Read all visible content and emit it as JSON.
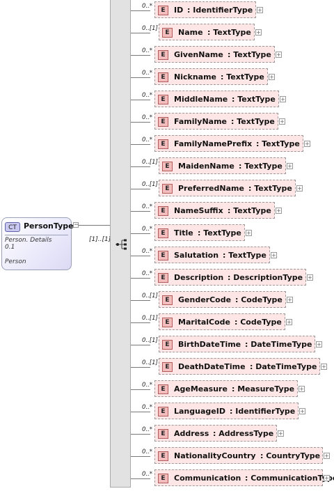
{
  "complex_type": {
    "badge": "CT",
    "name": "PersonType",
    "description": "Person. Details",
    "version": "0.1",
    "label": "Person",
    "collapse_symbol": "−"
  },
  "sequence": {
    "cardinality": "[1]..[1]"
  },
  "expand_symbol": "+",
  "element_badge": "E",
  "elements": [
    {
      "name": "ID",
      "type": ": IdentifierType",
      "card": "0..*"
    },
    {
      "name": "Name",
      "type": ": TextType",
      "card": "0..[1]"
    },
    {
      "name": "GivenName",
      "type": ": TextType",
      "card": "0..*"
    },
    {
      "name": "Nickname",
      "type": ": TextType",
      "card": "0..*"
    },
    {
      "name": "MiddleName",
      "type": ": TextType",
      "card": "0..*"
    },
    {
      "name": "FamilyName",
      "type": ": TextType",
      "card": "0..*"
    },
    {
      "name": "FamilyNamePrefix",
      "type": ": TextType",
      "card": "0..*"
    },
    {
      "name": "MaidenName",
      "type": ": TextType",
      "card": "0..[1]"
    },
    {
      "name": "PreferredName",
      "type": ": TextType",
      "card": "0..[1]"
    },
    {
      "name": "NameSuffix",
      "type": ": TextType",
      "card": "0..*"
    },
    {
      "name": "Title",
      "type": ": TextType",
      "card": "0..*"
    },
    {
      "name": "Salutation",
      "type": ": TextType",
      "card": "0..*"
    },
    {
      "name": "Description",
      "type": ": DescriptionType",
      "card": "0..*"
    },
    {
      "name": "GenderCode",
      "type": ": CodeType",
      "card": "0..[1]"
    },
    {
      "name": "MaritalCode",
      "type": ": CodeType",
      "card": "0..[1]"
    },
    {
      "name": "BirthDateTime",
      "type": ": DateTimeType",
      "card": "0..[1]"
    },
    {
      "name": "DeathDateTime",
      "type": ": DateTimeType",
      "card": "0..[1]"
    },
    {
      "name": "AgeMeasure",
      "type": ": MeasureType",
      "card": "0..*"
    },
    {
      "name": "LanguageID",
      "type": ": IdentifierType",
      "card": "0..*"
    },
    {
      "name": "Address",
      "type": ": AddressType",
      "card": "0..*"
    },
    {
      "name": "NationalityCountry",
      "type": ": CountryType",
      "card": "0..*"
    },
    {
      "name": "Communication",
      "type": ": CommunicationType",
      "card": "0..*"
    }
  ]
}
